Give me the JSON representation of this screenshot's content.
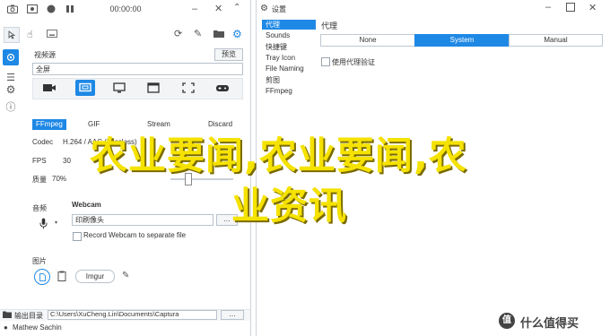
{
  "capture_window": {
    "title": "00:00:00",
    "presets_label": "视频源",
    "preset_button": "预览",
    "source_value": "全屏",
    "format_section": {
      "tabs": [
        "FFmpeg",
        "GIF",
        "Stream",
        "Discard"
      ],
      "codec_label": "Codec",
      "codec_value": "H.264 / AAC (Lossless)",
      "fps_label": "FPS",
      "fps_value": "30",
      "quality_label": "质量",
      "quality_value": "70%"
    },
    "audio_label": "音频",
    "webcam_label": "Webcam",
    "webcam_value": "印刷像头",
    "webcam_checkbox": "Record Webcam to separate file",
    "imgur_section_label": "图片",
    "imgur_button": "Imgur",
    "output_label": "输出目录",
    "output_path": "C:\\Users\\XuCheng.Lin\\Documents\\Captura",
    "author": "Mathew Sachin"
  },
  "settings_window": {
    "title": "设置",
    "sidebar": [
      "代理",
      "Sounds",
      "快捷键",
      "Tray Icon",
      "File Naming",
      "剪图",
      "FFmpeg"
    ],
    "selected_index": 0,
    "proxy_title": "代理",
    "proxy_options": [
      "None",
      "System",
      "Manual"
    ],
    "proxy_selected": 1,
    "proxy_checkbox": "使用代理验证"
  },
  "overlay": {
    "line1": "农业要闻,农业要闻,农",
    "line2": "业资讯"
  },
  "watermark": {
    "text": "什么值得买"
  },
  "colors": {
    "accent": "#1e88e5",
    "overlay": "#f5e200"
  }
}
